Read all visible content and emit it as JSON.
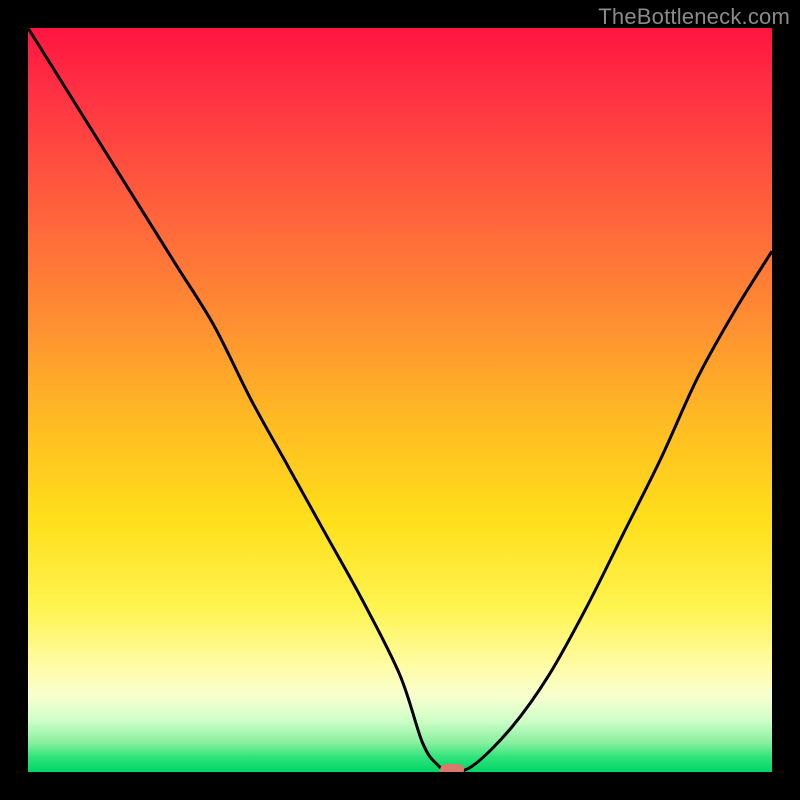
{
  "watermark": "TheBottleneck.com",
  "colors": {
    "frame_bg": "#000000",
    "curve": "#000000",
    "marker": "#d97a6a",
    "watermark": "#8a8a8a"
  },
  "chart_data": {
    "type": "line",
    "title": "",
    "xlabel": "",
    "ylabel": "",
    "xlim": [
      0,
      100
    ],
    "ylim": [
      0,
      100
    ],
    "grid": false,
    "legend": null,
    "series": [
      {
        "name": "bottleneck-curve",
        "x": [
          0,
          5,
          10,
          15,
          20,
          25,
          30,
          35,
          40,
          45,
          50,
          53,
          55,
          57,
          60,
          65,
          70,
          75,
          80,
          85,
          90,
          95,
          100
        ],
        "y": [
          100,
          92,
          84,
          76,
          68,
          60,
          50,
          41,
          32,
          23,
          13,
          4,
          1,
          0,
          1,
          6,
          13,
          22,
          32,
          42,
          53,
          62,
          70
        ]
      }
    ],
    "annotations": [
      {
        "name": "optimal-point-marker",
        "x": 57,
        "y": 0,
        "shape": "pill",
        "color": "#d97a6a"
      }
    ],
    "background_gradient": {
      "direction": "vertical",
      "stops": [
        {
          "pos": 0.0,
          "color": "#ff153f"
        },
        {
          "pos": 0.38,
          "color": "#ff8a33"
        },
        {
          "pos": 0.66,
          "color": "#ffdf1a"
        },
        {
          "pos": 0.9,
          "color": "#f6ffd0"
        },
        {
          "pos": 1.0,
          "color": "#00d568"
        }
      ]
    }
  }
}
